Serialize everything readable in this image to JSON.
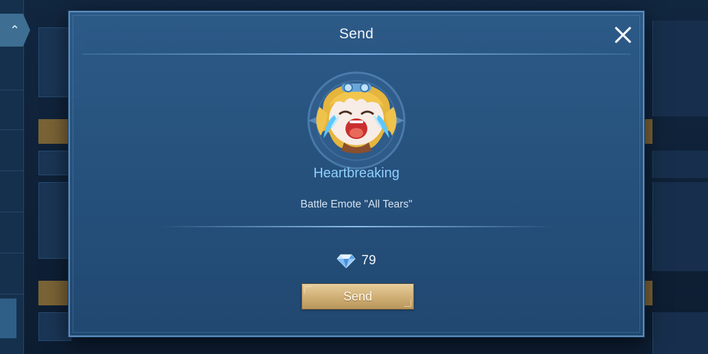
{
  "dialog": {
    "title": "Send",
    "item_name": "Heartbreaking",
    "item_description": "Battle Emote \"All Tears\"",
    "price": "79",
    "currency_icon": "diamond-icon",
    "send_label": "Send",
    "close_icon": "close-icon"
  },
  "colors": {
    "dialog_bg": "#2d5c8a",
    "item_name": "#8fd0ff",
    "send_button": "#d4b47a"
  }
}
